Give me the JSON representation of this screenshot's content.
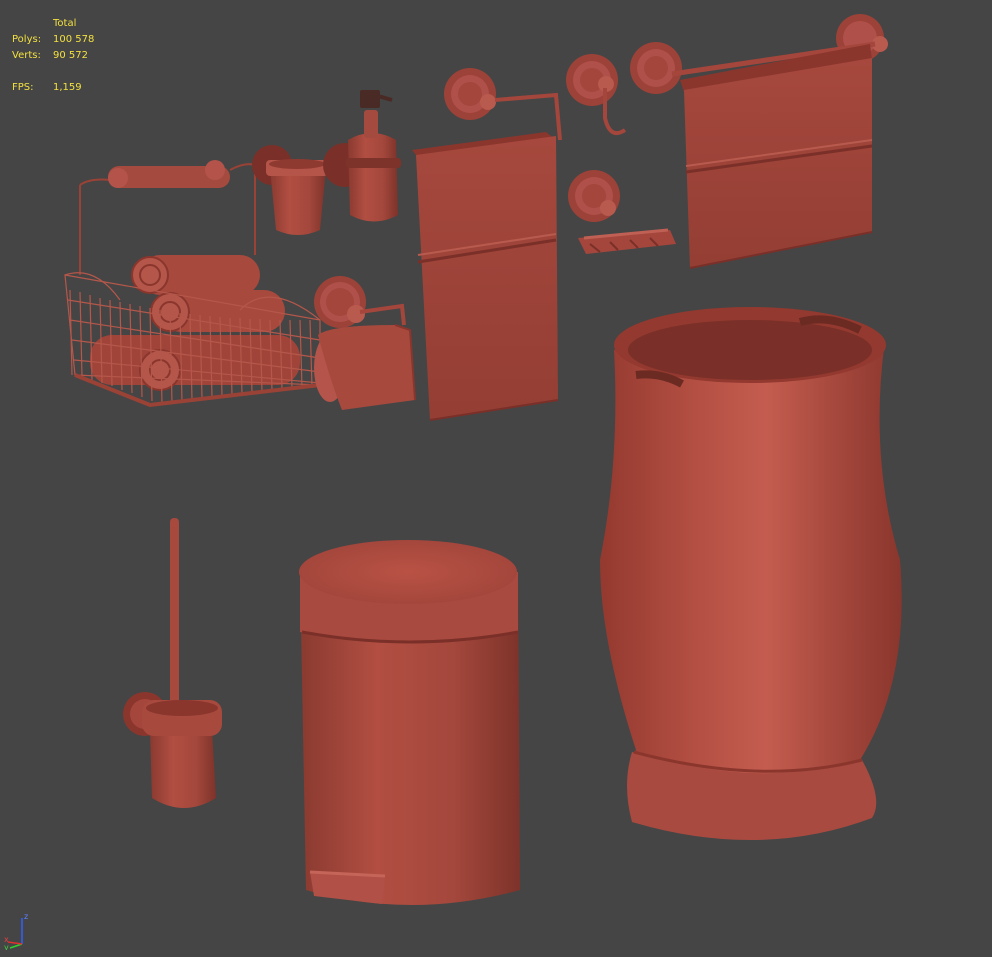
{
  "stats": {
    "header": "Total",
    "polys_label": "Polys:",
    "polys_value": "100 578",
    "verts_label": "Verts:",
    "verts_value": "90 572",
    "fps_label": "FPS:",
    "fps_value": "1,159"
  },
  "axis": {
    "z": "z",
    "y": "y",
    "x": "x"
  },
  "colors": {
    "background": "#454545",
    "model_base": "#a7483d",
    "model_light": "#c05a4c",
    "model_dark": "#7a3028",
    "stats_text": "#f2e040"
  },
  "objects": [
    "wire-basket-with-rolled-towels",
    "toilet-paper-holder",
    "tumbler-holder",
    "soap-dispenser",
    "towel-bar-with-towel",
    "robe-hook",
    "soap-dish",
    "large-towel-rail-with-towel",
    "toilet-brush-holder",
    "pedal-bin",
    "laundry-basket"
  ]
}
